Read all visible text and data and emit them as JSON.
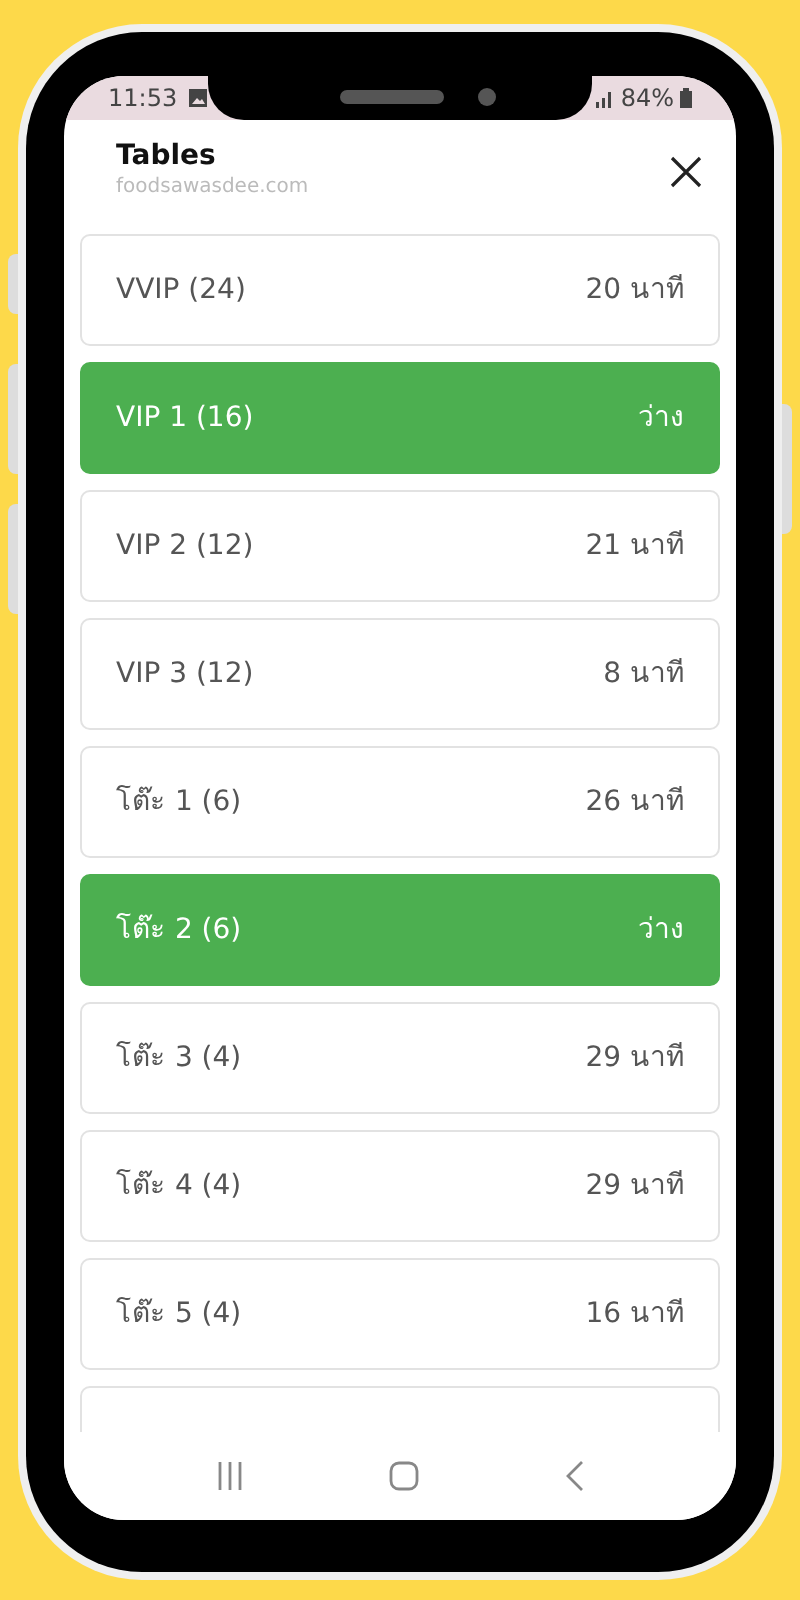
{
  "status_bar": {
    "time": "11:53",
    "battery": "84%"
  },
  "header": {
    "title": "Tables",
    "subtitle": "foodsawasdee.com"
  },
  "tables": [
    {
      "name": "VVIP (24)",
      "status": "20 นาที",
      "available": false
    },
    {
      "name": "VIP 1 (16)",
      "status": "ว่าง",
      "available": true
    },
    {
      "name": "VIP 2 (12)",
      "status": "21 นาที",
      "available": false
    },
    {
      "name": "VIP 3 (12)",
      "status": "8 นาที",
      "available": false
    },
    {
      "name": "โต๊ะ 1 (6)",
      "status": "26 นาที",
      "available": false
    },
    {
      "name": "โต๊ะ 2 (6)",
      "status": "ว่าง",
      "available": true
    },
    {
      "name": "โต๊ะ 3 (4)",
      "status": "29 นาที",
      "available": false
    },
    {
      "name": "โต๊ะ 4 (4)",
      "status": "29 นาที",
      "available": false
    },
    {
      "name": "โต๊ะ 5 (4)",
      "status": "16 นาที",
      "available": false
    }
  ]
}
